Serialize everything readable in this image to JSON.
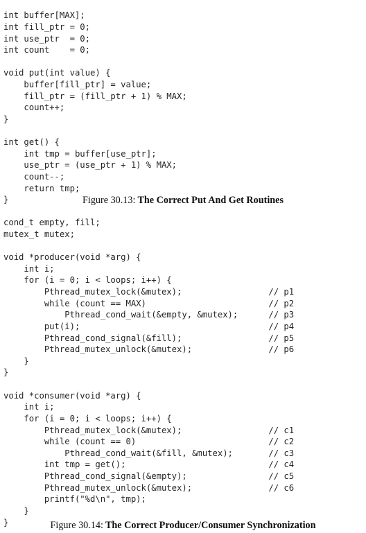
{
  "page": {
    "background": "#ffffff",
    "text_color": "#262626",
    "caption_color": "#101010"
  },
  "figures": [
    {
      "id": "figure-30-13",
      "caption_label": "Figure 30.13:",
      "caption_title": "The Correct Put And Get Routines",
      "code_lines": [
        "int buffer[MAX];",
        "int fill_ptr = 0;",
        "int use_ptr  = 0;",
        "int count    = 0;",
        "",
        "void put(int value) {",
        "    buffer[fill_ptr] = value;",
        "    fill_ptr = (fill_ptr + 1) % MAX;",
        "    count++;",
        "}",
        "",
        "int get() {",
        "    int tmp = buffer[use_ptr];",
        "    use_ptr = (use_ptr + 1) % MAX;",
        "    count--;",
        "    return tmp;",
        "}"
      ]
    },
    {
      "id": "figure-30-14",
      "caption_label": "Figure 30.14:",
      "caption_title": "The Correct Producer/Consumer Synchronization",
      "code_lines": [
        "cond_t empty, fill;",
        "mutex_t mutex;",
        "",
        "void *producer(void *arg) {",
        "    int i;",
        "    for (i = 0; i < loops; i++) {",
        "        Pthread_mutex_lock(&mutex);                 // p1",
        "        while (count == MAX)                        // p2",
        "            Pthread_cond_wait(&empty, &mutex);      // p3",
        "        put(i);                                     // p4",
        "        Pthread_cond_signal(&fill);                 // p5",
        "        Pthread_mutex_unlock(&mutex);               // p6",
        "    }",
        "}",
        "",
        "void *consumer(void *arg) {",
        "    int i;",
        "    for (i = 0; i < loops; i++) {",
        "        Pthread_mutex_lock(&mutex);                 // c1",
        "        while (count == 0)                          // c2",
        "            Pthread_cond_wait(&fill, &mutex);       // c3",
        "        int tmp = get();                            // c4",
        "        Pthread_cond_signal(&empty);                // c5",
        "        Pthread_mutex_unlock(&mutex);               // c6",
        "        printf(\"%d\\n\", tmp);",
        "    }",
        "}"
      ]
    }
  ]
}
